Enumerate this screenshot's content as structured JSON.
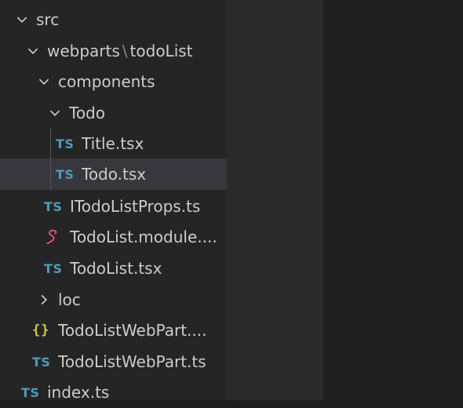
{
  "tree": {
    "src": "src",
    "webparts": "webparts",
    "path_separator": "\\",
    "todoList": "todoList",
    "components": "components",
    "todo_folder": "Todo",
    "title_file": "Title.tsx",
    "todo_file": "Todo.tsx",
    "props_file": "ITodoListProps.ts",
    "module_file": "TodoList.module....",
    "todolist_file": "TodoList.tsx",
    "loc": "loc",
    "manifest_file": "TodoListWebPart....",
    "webpart_file": "TodoListWebPart.ts",
    "index_file": "index.ts"
  },
  "icons": {
    "ts_label": "TS",
    "json_label": "{}",
    "ts_color": "#519aba",
    "json_color": "#cbcb41",
    "scss_color": "#f55385"
  },
  "selected_item": "Todo.tsx"
}
